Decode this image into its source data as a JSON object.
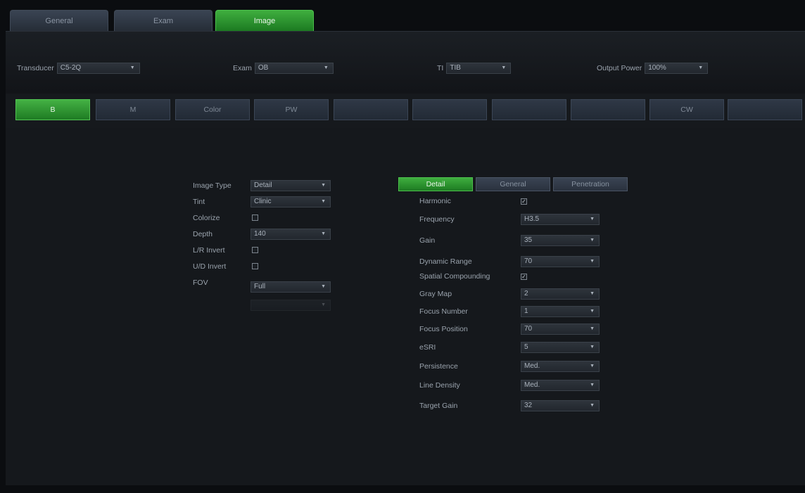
{
  "top_tabs": [
    {
      "label": "General",
      "active": false
    },
    {
      "label": "Exam",
      "active": false
    },
    {
      "label": "Image",
      "active": true
    }
  ],
  "header": {
    "transducer": {
      "label": "Transducer",
      "value": "C5-2Q"
    },
    "exam": {
      "label": "Exam",
      "value": "OB"
    },
    "ti": {
      "label": "TI",
      "value": "TIB"
    },
    "output_power": {
      "label": "Output Power",
      "value": "100%"
    }
  },
  "mode_tabs": [
    {
      "label": "B",
      "active": true
    },
    {
      "label": "M",
      "active": false
    },
    {
      "label": "Color",
      "active": false
    },
    {
      "label": "PW",
      "active": false
    },
    {
      "label": "",
      "active": false
    },
    {
      "label": "",
      "active": false
    },
    {
      "label": "",
      "active": false
    },
    {
      "label": "",
      "active": false
    },
    {
      "label": "CW",
      "active": false
    },
    {
      "label": "",
      "active": false
    }
  ],
  "left_panel": {
    "image_type": {
      "label": "Image Type",
      "value": "Detail"
    },
    "tint": {
      "label": "Tint",
      "value": "Clinic"
    },
    "colorize": {
      "label": "Colorize",
      "checked": false
    },
    "depth": {
      "label": "Depth",
      "value": "140"
    },
    "lr_invert": {
      "label": "L/R Invert",
      "checked": false
    },
    "ud_invert": {
      "label": "U/D Invert",
      "checked": false
    },
    "fov": {
      "label": "FOV",
      "value": "Full"
    }
  },
  "sub_tabs": [
    {
      "label": "Detail",
      "active": true
    },
    {
      "label": "General",
      "active": false
    },
    {
      "label": "Penetration",
      "active": false
    }
  ],
  "right_panel": {
    "harmonic": {
      "label": "Harmonic",
      "checked": true
    },
    "frequency": {
      "label": "Frequency",
      "value": "H3.5"
    },
    "gain": {
      "label": "Gain",
      "value": "35"
    },
    "dynamic_range": {
      "label": "Dynamic Range",
      "value": "70"
    },
    "spatial_compounding": {
      "label": "Spatial Compounding",
      "checked": true
    },
    "gray_map": {
      "label": "Gray Map",
      "value": "2"
    },
    "focus_number": {
      "label": "Focus Number",
      "value": "1"
    },
    "focus_position": {
      "label": "Focus Position",
      "value": "70"
    },
    "esri": {
      "label": "eSRI",
      "value": "5"
    },
    "persistence": {
      "label": "Persistence",
      "value": "Med."
    },
    "line_density": {
      "label": "Line Density",
      "value": "Med."
    },
    "target_gain": {
      "label": "Target Gain",
      "value": "32"
    }
  },
  "icons": {
    "dropdown_arrow": "▼",
    "check_mark": "✓"
  },
  "colors": {
    "accent_green": "#2f9a34",
    "tab_blue": "#2a3340",
    "background": "#15181c"
  }
}
